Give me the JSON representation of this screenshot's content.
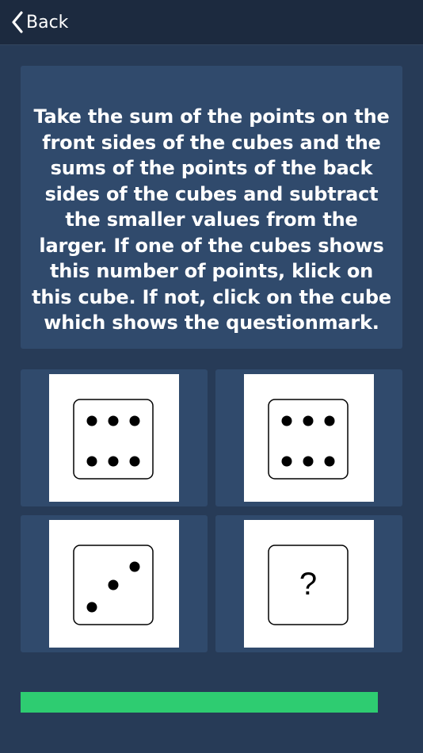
{
  "nav": {
    "back_label": "Back"
  },
  "question": {
    "text": "Take the sum of the points on the front sides of the cubes and the sums of the points of the back sides of the cubes and subtract the smaller values from the larger. If one of the cubes shows this number of points, klick on this cube. If not, click on the cube which shows the questionmark."
  },
  "choices": [
    {
      "id": "cube-1",
      "pips": 6
    },
    {
      "id": "cube-2",
      "pips": 6
    },
    {
      "id": "cube-3",
      "pips": 3
    },
    {
      "id": "cube-4",
      "pips": 0,
      "symbol": "?"
    }
  ],
  "progress": {
    "fraction": 0.935,
    "color": "#2ecc71"
  },
  "colors": {
    "background": "#273b57",
    "topbar": "#1c2a3f",
    "card": "#304a6c"
  }
}
